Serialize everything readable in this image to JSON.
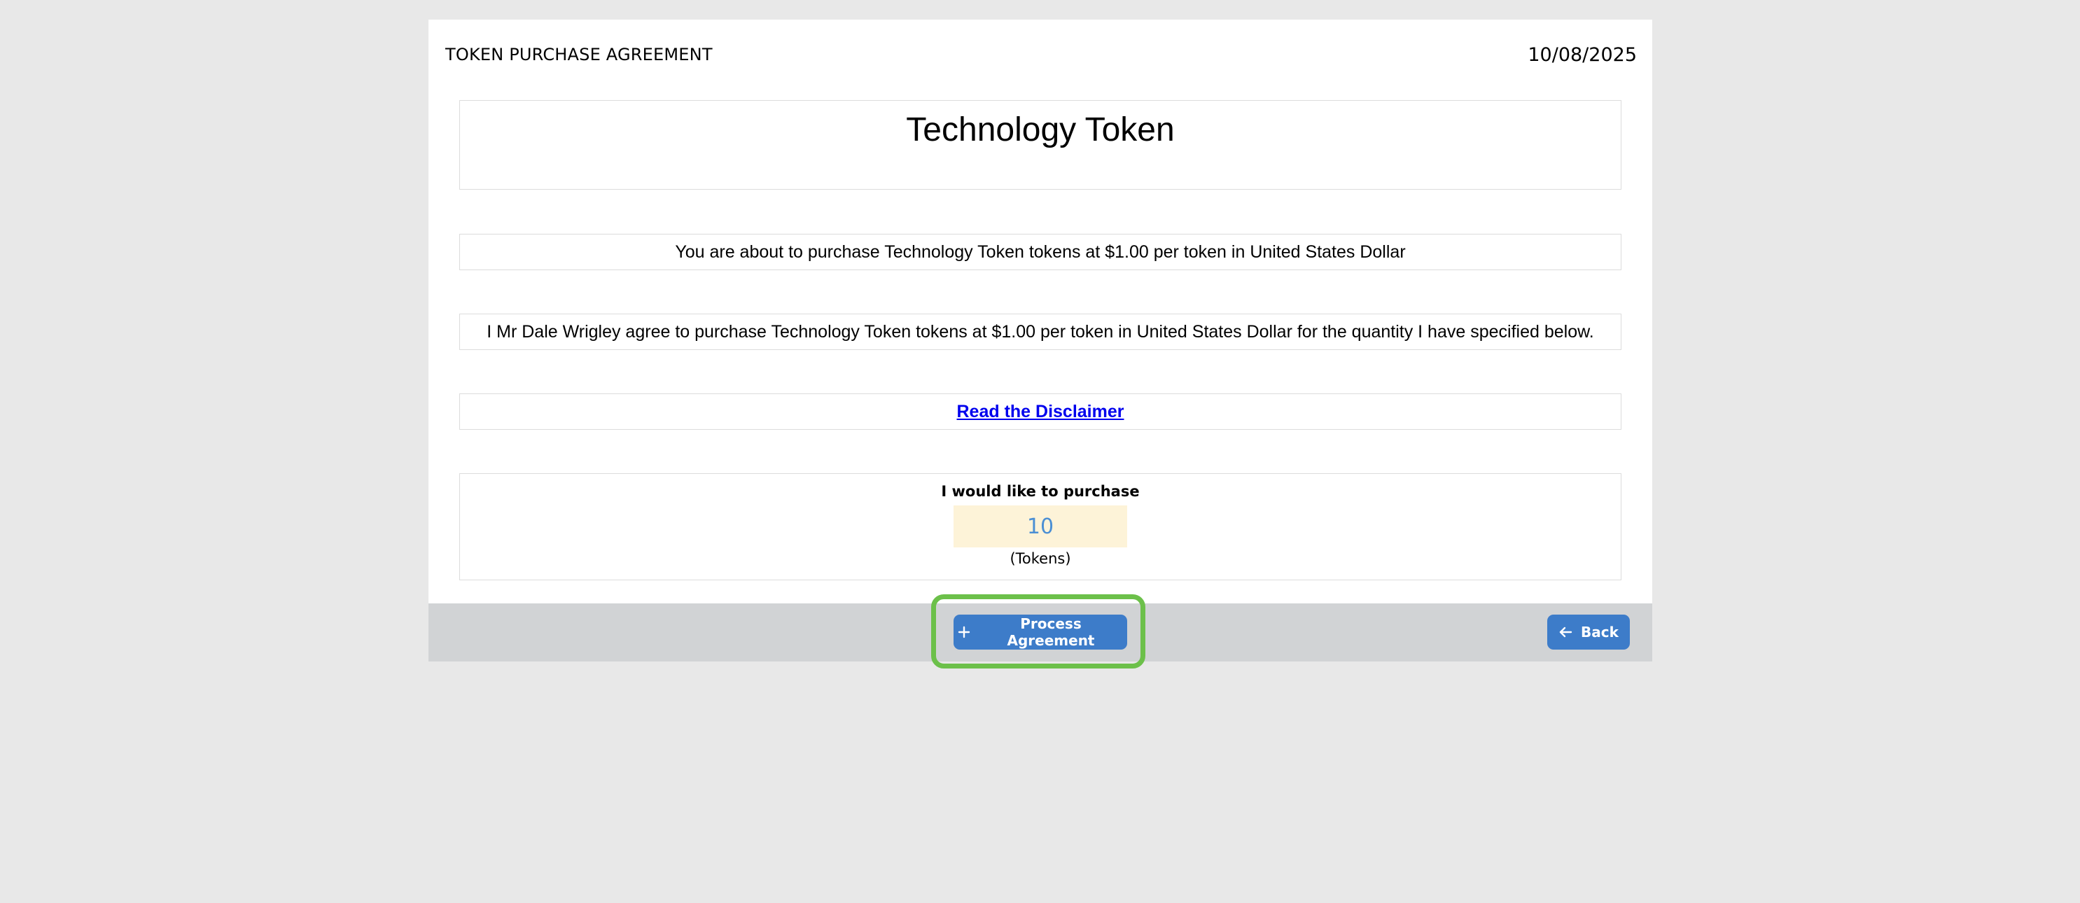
{
  "document": {
    "type_label": "TOKEN PURCHASE AGREEMENT",
    "date": "10/08/2025",
    "title": "Technology Token"
  },
  "agreement": {
    "intro_text": "You are about to purchase Technology Token tokens at $1.00 per token in United States Dollar",
    "agree_text": "I Mr Dale Wrigley agree to purchase Technology Token tokens at $1.00 per token in United States Dollar for the quantity I have specified below.",
    "disclaimer_link": "Read the Disclaimer"
  },
  "purchase": {
    "label": "I would like to purchase",
    "quantity": "10",
    "unit": "(Tokens)"
  },
  "footer": {
    "process_label": "Process Agreement",
    "back_label": "Back"
  },
  "colors": {
    "button": "#3d7cc9",
    "highlight": "#6cc04a",
    "input_bg": "#fdf3d8",
    "link": "#0000ee"
  },
  "icons": {
    "process": "plus-icon",
    "back": "arrow-left-icon"
  }
}
